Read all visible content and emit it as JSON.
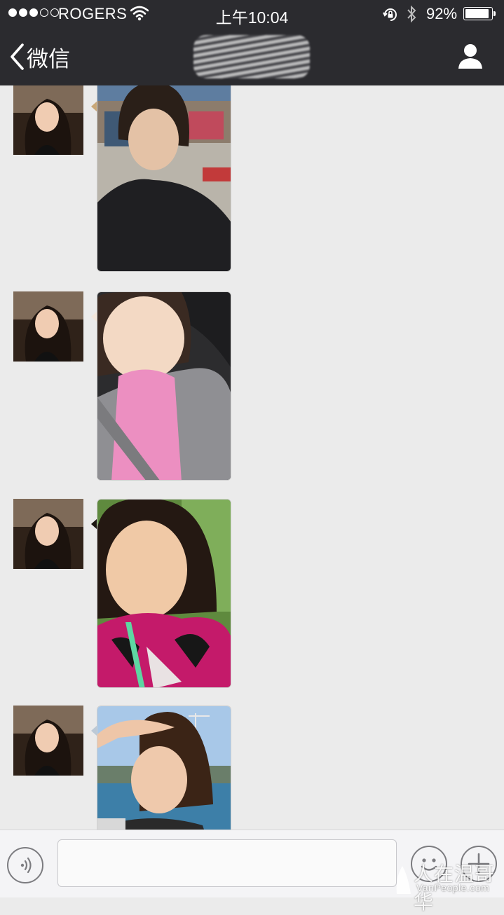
{
  "status_bar": {
    "carrier": "ROGERS",
    "signal_bars_filled": 3,
    "signal_bars_total": 5,
    "time": "上午10:04",
    "battery_percent_text": "92%",
    "battery_level": 0.92
  },
  "nav": {
    "back_label": "微信",
    "back_icon": "chevron-left-icon",
    "profile_icon": "person-icon"
  },
  "messages": [
    {
      "sender": "contact",
      "type": "image",
      "avatar": "contact-avatar"
    },
    {
      "sender": "contact",
      "type": "image",
      "avatar": "contact-avatar"
    },
    {
      "sender": "contact",
      "type": "image",
      "avatar": "contact-avatar"
    },
    {
      "sender": "contact",
      "type": "image",
      "avatar": "contact-avatar"
    }
  ],
  "input_bar": {
    "voice_icon": "voice-icon",
    "text_value": "",
    "emoji_icon": "emoji-icon",
    "plus_icon": "plus-icon"
  },
  "watermark": {
    "cn": "人在温哥华",
    "en": "VanPeople.com"
  },
  "colors": {
    "bar_bg": "#2b2b2f",
    "chat_bg": "#ebebeb",
    "input_bar_bg": "#f4f4f6"
  }
}
